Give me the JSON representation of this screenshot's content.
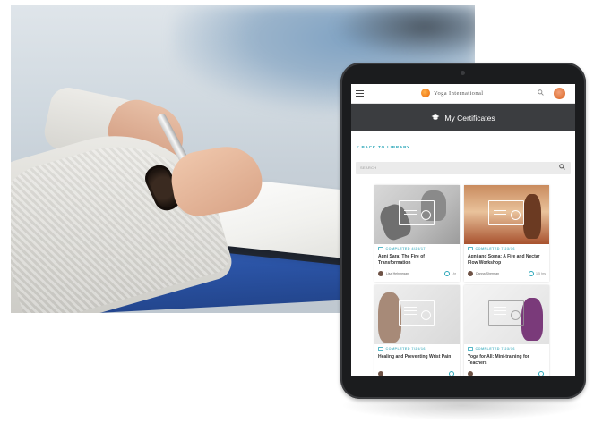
{
  "app": {
    "brand_name": "Yoga International",
    "page_title": "My Certificates",
    "back_link": "< BACK TO LIBRARY",
    "search_placeholder": "SEARCH"
  },
  "icons": {
    "menu": "hamburger-icon",
    "logo": "yoga-international-logo",
    "search": "magnifier-icon",
    "profile": "avatar",
    "certificate": "graduation-cap-icon",
    "duration": "clock-icon"
  },
  "colors": {
    "accent": "#29a6b8",
    "header_band": "#3b3d40",
    "logo_orange": "#f07d1a"
  },
  "certificates": [
    {
      "status": "COMPLETED 4/28/17",
      "title": "Agni Sara: The Fire of Transformation",
      "author": "Lisa Hehmegan",
      "duration": "1hr"
    },
    {
      "status": "COMPLETED 7/23/16",
      "title": "Agni and Soma: A Fire and Nectar Flow Workshop",
      "author": "Danna Sherman",
      "duration": "1.5 hrs"
    },
    {
      "status": "COMPLETED 7/23/16",
      "title": "Healing and Preventing Wrist Pain",
      "author": "",
      "duration": ""
    },
    {
      "status": "COMPLETED 7/23/16",
      "title": "Yoga for All: Mini-training for Teachers",
      "author": "",
      "duration": ""
    }
  ]
}
